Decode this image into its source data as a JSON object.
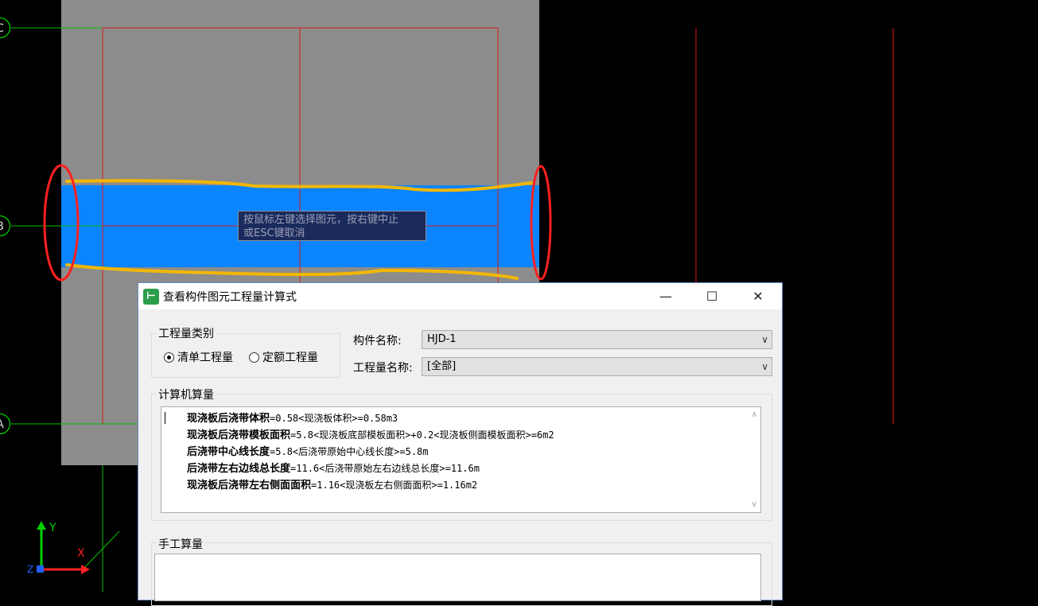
{
  "axes": {
    "c": "C",
    "b": "B",
    "a": "A"
  },
  "tooltip": {
    "line1": "按鼠标左键选择图元，按右键中止",
    "line2": "或ESC键取消"
  },
  "ucs": {
    "y": "Y",
    "x": "X",
    "z": "Z"
  },
  "colors": {
    "background": "#000000",
    "slab": "#8c8c8c",
    "selection": "#0a84ff",
    "grid": "#e01818",
    "markup_yellow": "#f2b705",
    "markup_red": "#ff2020",
    "axis_green": "#00c000"
  },
  "dialog": {
    "title": "查看构件图元工程量计算式",
    "controls": {
      "minimize": "—",
      "maximize": "☐",
      "close": "✕"
    },
    "quantity_type": {
      "label": "工程量类别",
      "options": [
        {
          "label": "清单工程量",
          "selected": true
        },
        {
          "label": "定额工程量",
          "selected": false
        }
      ]
    },
    "component_name": {
      "label": "构件名称:",
      "value": "HJD-1"
    },
    "quantity_name": {
      "label": "工程量名称:",
      "value": "[全部]"
    },
    "computer_calc": {
      "label": "计算机算量",
      "lines": [
        {
          "name": "现浇板后浇带体积",
          "formula": "=0.58<现浇板体积>=0.58m3"
        },
        {
          "name": "现浇板后浇带模板面积",
          "formula": "=5.8<现浇板底部模板面积>+0.2<现浇板侧面模板面积>=6m2"
        },
        {
          "name": "后浇带中心线长度",
          "formula": "=5.8<后浇带原始中心线长度>=5.8m"
        },
        {
          "name": "后浇带左右边线总长度",
          "formula": "=11.6<后浇带原始左右边线总长度>=11.6m"
        },
        {
          "name": "现浇板后浇带左右侧面面积",
          "formula": "=1.16<现浇板左右侧面面积>=1.16m2"
        }
      ]
    },
    "manual_calc": {
      "label": "手工算量"
    }
  }
}
